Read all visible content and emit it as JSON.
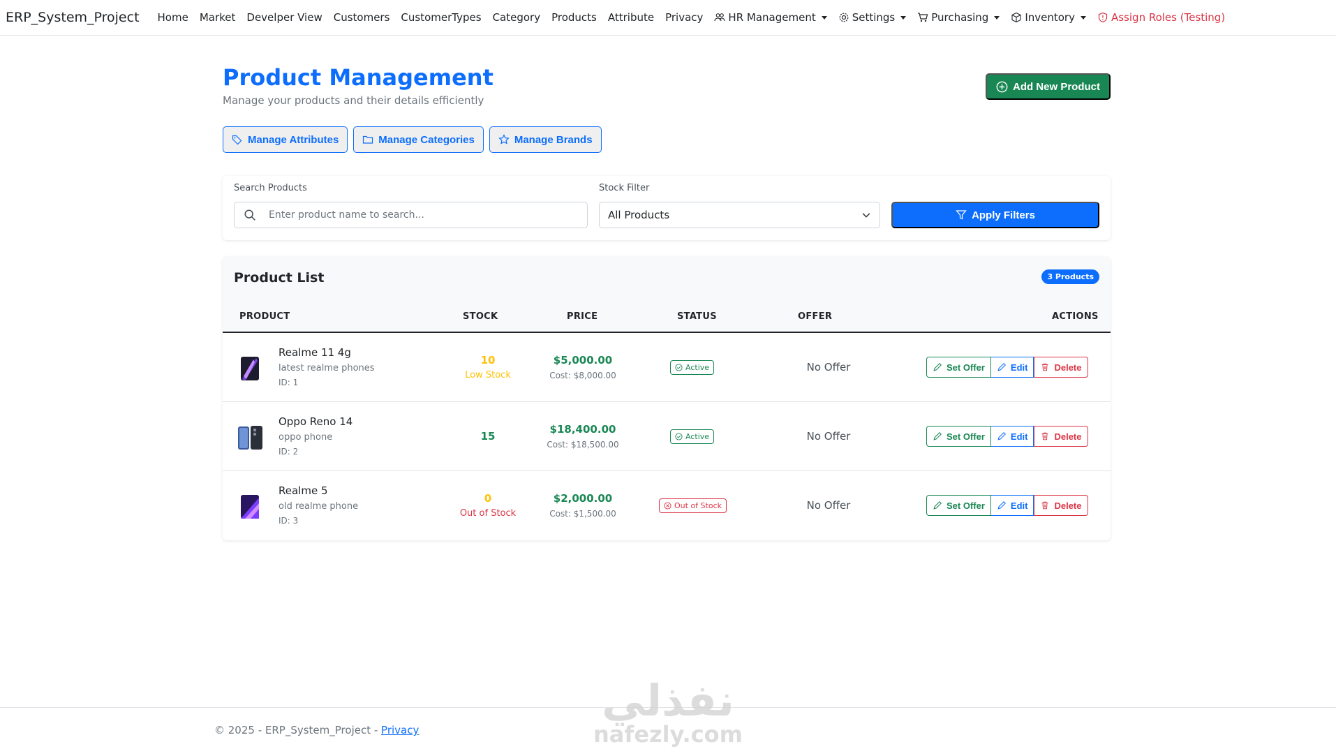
{
  "navbar": {
    "brand": "ERP_System_Project",
    "links": [
      "Home",
      "Market",
      "Develper View",
      "Customers",
      "CustomerTypes",
      "Category",
      "Products",
      "Attribute",
      "Privacy"
    ],
    "dropdowns": [
      {
        "label": "HR Management",
        "icon": "people-icon"
      },
      {
        "label": "Settings",
        "icon": "gear-icon"
      },
      {
        "label": "Purchasing",
        "icon": "cart-icon"
      },
      {
        "label": "Inventory",
        "icon": "box-icon"
      }
    ],
    "assign_roles": "Assign Roles (Testing)"
  },
  "header": {
    "title": "Product Management",
    "subtitle": "Manage your products and their details efficiently",
    "add_button": "Add New Product"
  },
  "manage_buttons": {
    "attributes": "Manage Attributes",
    "categories": "Manage Categories",
    "brands": "Manage Brands"
  },
  "filters": {
    "search_label": "Search Products",
    "search_placeholder": "Enter product name to search...",
    "search_value": "",
    "stock_label": "Stock Filter",
    "stock_selected": "All Products",
    "apply_label": "Apply Filters"
  },
  "product_list": {
    "title": "Product List",
    "count_badge": "3 Products",
    "columns": {
      "product": "PRODUCT",
      "stock": "STOCK",
      "price": "PRICE",
      "status": "STATUS",
      "offer": "OFFER",
      "actions": "ACTIONS"
    },
    "action_labels": {
      "set_offer": "Set Offer",
      "edit": "Edit",
      "delete": "Delete"
    },
    "rows": [
      {
        "name": "Realme 11 4g",
        "description": "latest realme phones",
        "id": "ID: 1",
        "stock": "10",
        "stock_note": "Low Stock",
        "price": "$5,000.00",
        "cost": "Cost: $8,000.00",
        "status": "Active",
        "offer": "No Offer"
      },
      {
        "name": "Oppo Reno 14",
        "description": "oppo phone",
        "id": "ID: 2",
        "stock": "15",
        "stock_note": "",
        "price": "$18,400.00",
        "cost": "Cost: $18,500.00",
        "status": "Active",
        "offer": "No Offer"
      },
      {
        "name": "Realme 5",
        "description": "old realme phone",
        "id": "ID: 3",
        "stock": "0",
        "stock_note": "Out of Stock",
        "price": "$2,000.00",
        "cost": "Cost: $1,500.00",
        "status": "Out of Stock",
        "offer": "No Offer"
      }
    ]
  },
  "footer": {
    "text": "© 2025 - ERP_System_Project - ",
    "privacy_link": "Privacy"
  },
  "watermark": {
    "arabic": "نفذلي",
    "latin": "nafezly.com"
  },
  "colors": {
    "primary": "#0d6efd",
    "success": "#198754",
    "danger": "#dc3545",
    "warning": "#ffc107",
    "muted": "#6c757d"
  }
}
